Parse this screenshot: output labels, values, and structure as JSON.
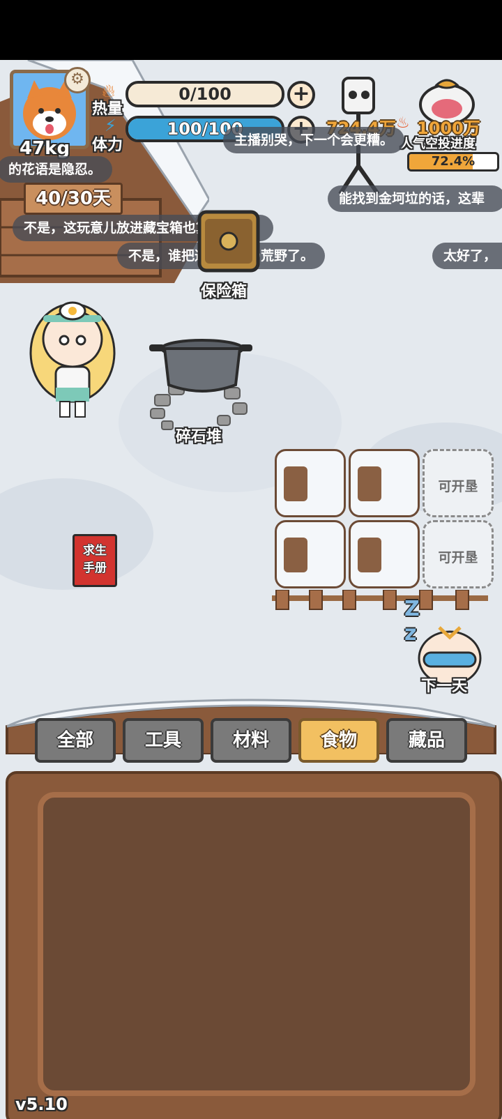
{
  "player": {
    "weight": "47kg",
    "heat_label": "热量",
    "stamina_label": "体力",
    "heat_value": "0/100",
    "heat_fraction": 0.0,
    "stamina_value": "100/100",
    "stamina_fraction": 1.0,
    "days": "40/30天",
    "plus_symbol": "+"
  },
  "stream": {
    "viewers": "724.4万",
    "goal": "1000万",
    "airdrop_label": "人气空投进度",
    "airdrop_percent": "72.4%",
    "airdrop_fraction": 0.724
  },
  "danmaku": [
    "主播别哭，下一个会更糟。",
    "的花语是隐忍。",
    "能找到金坷垃的话，这辈",
    "不是，这玩意儿放进藏宝箱也算合理吗？",
    "不是，谁把这玩意儿扔荒野了。",
    "太好了，"
  ],
  "world": {
    "safe_label": "保险箱",
    "rubble_label": "碎石堆",
    "plot_open_label": "可开垦",
    "manual_label_line1": "求生",
    "manual_label_line2": "手册",
    "next_day_label": "下一天"
  },
  "tabs": [
    {
      "label": "全部",
      "active": false
    },
    {
      "label": "工具",
      "active": false
    },
    {
      "label": "材料",
      "active": false
    },
    {
      "label": "食物",
      "active": true
    },
    {
      "label": "藏品",
      "active": false
    }
  ],
  "version": "v5.10",
  "icons": [
    "settings-gear-icon",
    "flame-icon",
    "lightning-icon",
    "camera-icon",
    "gift-icon",
    "sleep-icon"
  ],
  "colors": {
    "stamina_fill": "#3ba3d8",
    "airdrop_fill": "#f0a63a",
    "active_tab": "#f2c061",
    "inventory_panel": "#6b4a35"
  }
}
